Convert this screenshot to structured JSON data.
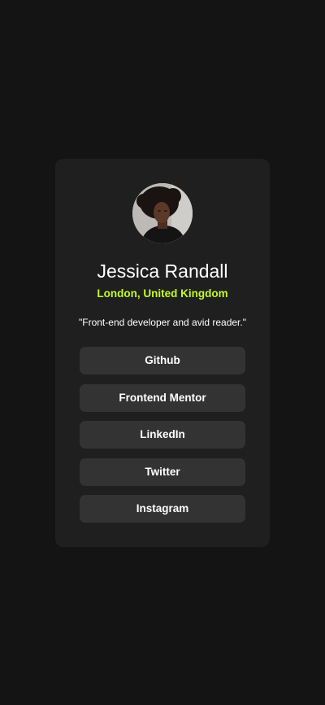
{
  "profile": {
    "name": "Jessica Randall",
    "location": "London, United Kingdom",
    "bio": "\"Front-end developer and avid reader.\""
  },
  "links": [
    {
      "label": "Github"
    },
    {
      "label": "Frontend Mentor"
    },
    {
      "label": "LinkedIn"
    },
    {
      "label": "Twitter"
    },
    {
      "label": "Instagram"
    }
  ],
  "colors": {
    "page_background": "#141414",
    "card_background": "#1f1f1f",
    "button_background": "#333333",
    "accent": "#c4f82a",
    "text": "#ffffff"
  }
}
